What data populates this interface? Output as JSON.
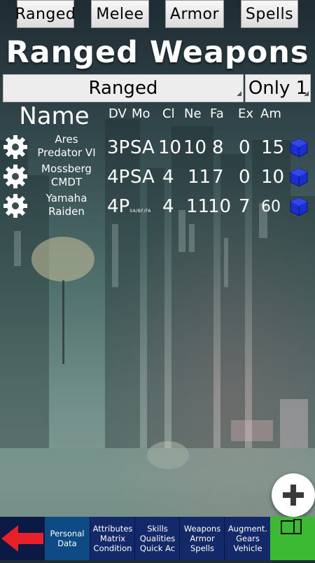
{
  "top_tabs": [
    "Ranged",
    "Melee",
    "Armor",
    "Spells"
  ],
  "title": "Ranged Weapons",
  "filter": {
    "category": "Ranged",
    "scope": "Only 1"
  },
  "columns": {
    "name": "Name",
    "dv": "DV",
    "mode": "Mo",
    "cl": "Cl",
    "ne": "Ne",
    "fa": "Fa",
    "ex": "Ex",
    "am": "Am"
  },
  "weapons": [
    {
      "name_line1": "Ares",
      "name_line2": "Predator VI",
      "dv": "3P",
      "dv_sub": "",
      "mode": "SA",
      "cl": "10",
      "ne": "10",
      "fa": "8",
      "ex": "0",
      "am": "15"
    },
    {
      "name_line1": "Mossberg",
      "name_line2": "CMDT",
      "dv": "4P",
      "dv_sub": "",
      "mode": "SA",
      "cl": "4",
      "ne": "11",
      "fa": "7",
      "ex": "0",
      "am": "10"
    },
    {
      "name_line1": "Yamaha",
      "name_line2": "Raiden",
      "dv": "4P",
      "dv_sub": "SA/BF/FA",
      "mode": "",
      "cl": "4",
      "ne": "11",
      "fa": "10",
      "ex": "7",
      "am": "60"
    }
  ],
  "bottom_nav": [
    {
      "lines": [
        "Personal",
        "Data"
      ]
    },
    {
      "lines": [
        "Attributes",
        "Matrix",
        "Condition"
      ]
    },
    {
      "lines": [
        "Skills",
        "Qualities",
        "Quick Ac"
      ]
    },
    {
      "lines": [
        "Weapons",
        "Armor",
        "Spells"
      ]
    },
    {
      "lines": [
        "Augment.",
        "Gears",
        "Vehicle"
      ]
    }
  ],
  "colors": {
    "accent_nav": "#0b1a44",
    "save_green": "#3cba34",
    "back_red": "#e8202a",
    "ammo_blue": "#1a2fd0"
  },
  "icons": {
    "settings": "gear-icon",
    "ammo": "cube-icon",
    "add": "plus-icon",
    "back": "arrow-left-icon",
    "save": "save-file-icon"
  }
}
